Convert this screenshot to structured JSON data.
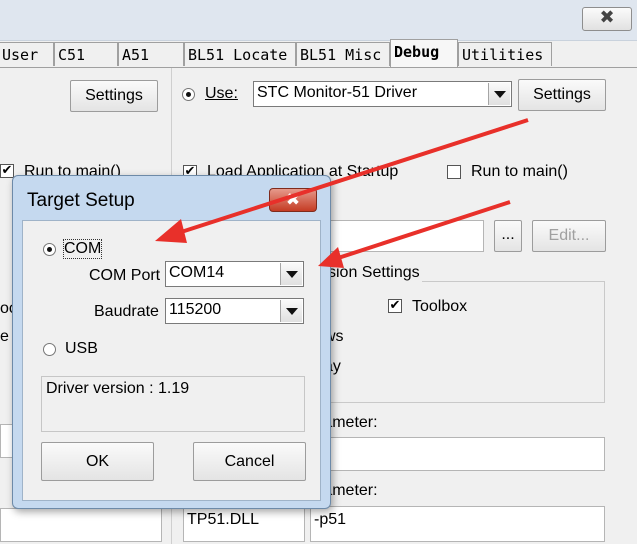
{
  "window": {
    "close_glyph": "✖"
  },
  "tabs": [
    "User",
    "C51",
    "A51",
    "BL51 Locate",
    "BL51 Misc",
    "Debug",
    "Utilities"
  ],
  "left_settings_label": "Settings",
  "left_run_to_main": "Run to main()",
  "right": {
    "use_label": "Use:",
    "driver": "STC Monitor-51 Driver",
    "settings_label": "Settings",
    "load_app": "Load Application at Startup",
    "run_to_main": "Run to main()",
    "browse_label": "...",
    "edit_label": "Edit...",
    "session_settings": "ssion Settings",
    "toolbox": "Toolbox",
    "frag_1": "ws",
    "frag_2": "ay",
    "param1": "rameter:",
    "param2": "rameter:",
    "dll_value": "TP51.DLL",
    "dll_param": "-p51"
  },
  "left_frags": [
    "oo",
    "e"
  ],
  "dialog": {
    "title": "Target Setup",
    "close_glyph": "✖",
    "com_label": "COM",
    "com_port_label": "COM Port",
    "com_port_value": "COM14",
    "baud_label": "Baudrate",
    "baud_value": "115200",
    "usb_label": "USB",
    "driver_version": "Driver version : 1.19",
    "ok_label": "OK",
    "cancel_label": "Cancel"
  },
  "colors": {
    "annotation_arrow": "#e8302a",
    "dialog_frame": "#c5d9ef",
    "close_red": "#c53c24"
  }
}
